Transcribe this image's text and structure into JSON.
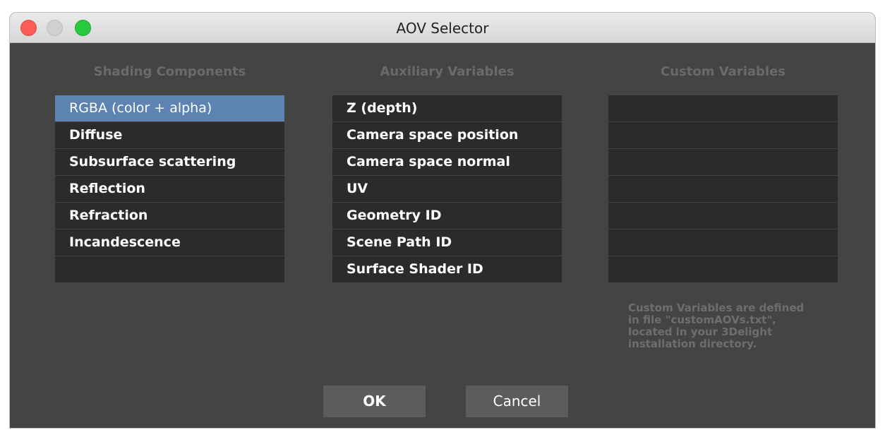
{
  "window": {
    "title": "AOV Selector"
  },
  "columns": [
    {
      "header": "Shading Components",
      "items": [
        {
          "label": "RGBA (color + alpha)",
          "selected": true
        },
        {
          "label": "Diffuse",
          "selected": false
        },
        {
          "label": "Subsurface scattering",
          "selected": false
        },
        {
          "label": "Reflection",
          "selected": false
        },
        {
          "label": "Refraction",
          "selected": false
        },
        {
          "label": "Incandescence",
          "selected": false
        },
        {
          "label": "",
          "selected": false
        }
      ]
    },
    {
      "header": "Auxiliary Variables",
      "items": [
        {
          "label": "Z (depth)",
          "selected": false
        },
        {
          "label": "Camera space position",
          "selected": false
        },
        {
          "label": "Camera space normal",
          "selected": false
        },
        {
          "label": "UV",
          "selected": false
        },
        {
          "label": "Geometry ID",
          "selected": false
        },
        {
          "label": "Scene Path ID",
          "selected": false
        },
        {
          "label": "Surface Shader ID",
          "selected": false
        }
      ]
    },
    {
      "header": "Custom Variables",
      "items": [
        {
          "label": ""
        },
        {
          "label": ""
        },
        {
          "label": ""
        },
        {
          "label": ""
        },
        {
          "label": ""
        },
        {
          "label": ""
        },
        {
          "label": ""
        }
      ]
    }
  ],
  "note": {
    "lines": [
      "Custom Variables are defined",
      "in file \"customAOVs.txt\",",
      "located in your 3Delight",
      "installation directory."
    ]
  },
  "buttons": {
    "ok": "OK",
    "cancel": "Cancel"
  },
  "colors": {
    "background": "#444444",
    "row": "#2b2b2b",
    "selected_row": "#5d83b3",
    "header_text": "#6a6a6a",
    "button": "#5c5c5c",
    "close": "#fc5b57",
    "minimize_inactive": "#d0d0d0",
    "maximize": "#27c93f"
  }
}
